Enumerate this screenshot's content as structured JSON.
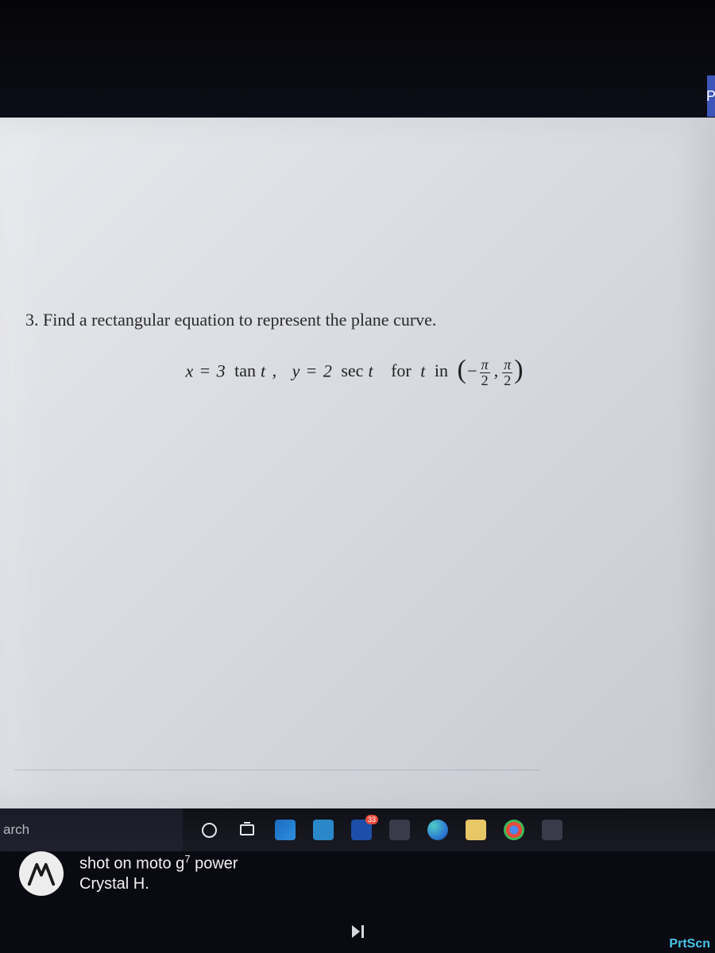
{
  "page_tab_letter": "P",
  "problem": {
    "number": "3.",
    "prompt": "Find a rectangular equation to represent the plane curve.",
    "equation": {
      "x_lhs": "x",
      "x_rhs_coeff": "3",
      "x_rhs_func": "tan",
      "x_rhs_arg": "t",
      "y_lhs": "y",
      "y_rhs_coeff": "2",
      "y_rhs_func": "sec",
      "y_rhs_arg": "t",
      "for_text": "for",
      "param": "t",
      "in_text": "in",
      "interval_lower_num": "π",
      "interval_lower_den": "2",
      "interval_upper_num": "π",
      "interval_upper_den": "2",
      "interval_lower_sign": "−"
    }
  },
  "taskbar": {
    "search_placeholder": "arch",
    "badge_count": "33"
  },
  "watermark": {
    "line1_prefix": "shot on moto g",
    "line1_sup": "7",
    "line1_suffix": " power",
    "line2": "Crystal H."
  },
  "key_label": "PrtScn"
}
